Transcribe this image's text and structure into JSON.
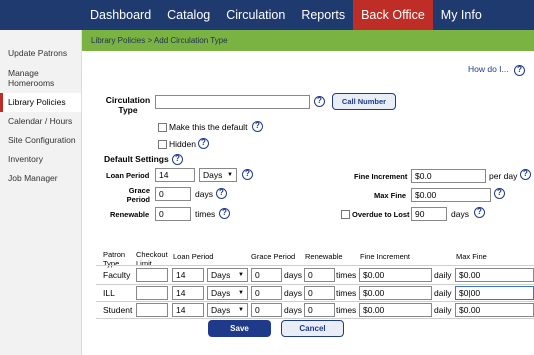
{
  "nav": [
    "Dashboard",
    "Catalog",
    "Circulation",
    "Reports",
    "Back Office",
    "My Info"
  ],
  "sidebar": [
    "Update Patrons",
    "Manage Homerooms",
    "Library Policies",
    "Calendar / Hours",
    "Site Configuration",
    "Inventory",
    "Job Manager"
  ],
  "breadcrumb": "Library Policies > Add Circulation Type",
  "how_do_i": "How do I...",
  "form": {
    "circ_type_label": "Circulation Type",
    "circ_type_value": "",
    "call_number_button": "Call Number",
    "make_default_label": "Make this the default",
    "hidden_label": "Hidden",
    "default_settings_label": "Default Settings",
    "loan_period_label": "Loan Period",
    "loan_period_value": "14",
    "loan_period_unit": "Days",
    "grace_period_label": "Grace Period",
    "grace_period_value": "0",
    "grace_unit": "days",
    "renewable_label": "Renewable",
    "renewable_value": "0",
    "renewable_unit": "times",
    "fine_increment_label": "Fine Increment",
    "fine_increment_value": "$0.0",
    "per_day": "per day",
    "max_fine_label": "Max Fine",
    "max_fine_value": "$0.00",
    "overdue_label": "Overdue to Lost",
    "overdue_value": "90",
    "overdue_unit": "days"
  },
  "table": {
    "headers": {
      "patron_type": "Patron Type",
      "checkout_limit": "Checkout Limit",
      "loan_period": "Loan Period",
      "grace_period": "Grace Period",
      "renewable": "Renewable",
      "fine_increment": "Fine Increment",
      "max_fine": "Max Fine"
    },
    "rows": [
      {
        "type": "Faculty",
        "limit": "",
        "loan": "14",
        "unit": "Days",
        "grace": "0",
        "days": "days",
        "renew": "0",
        "times": "times",
        "fine": "$0.00",
        "daily": "daily",
        "max": "$0.00"
      },
      {
        "type": "ILL",
        "limit": "",
        "loan": "14",
        "unit": "Days",
        "grace": "0",
        "days": "days",
        "renew": "0",
        "times": "times",
        "fine": "$0.00",
        "daily": "daily",
        "max": "$0|00"
      },
      {
        "type": "Student",
        "limit": "",
        "loan": "14",
        "unit": "Days",
        "grace": "0",
        "days": "days",
        "renew": "0",
        "times": "times",
        "fine": "$0.00",
        "daily": "daily",
        "max": "$0.00"
      }
    ]
  },
  "buttons": {
    "save": "Save",
    "cancel": "Cancel"
  },
  "help_glyph": "?",
  "dropdown_arrow": "▼",
  "colors": {
    "topbar": "#1f3a6f",
    "active_tab": "#bf2e26",
    "breadcrumb": "#7bb342",
    "link": "#1f3a8a"
  }
}
